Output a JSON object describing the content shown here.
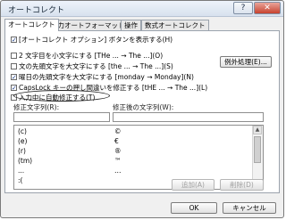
{
  "window": {
    "title": "オートコレクト",
    "help_label": "?",
    "close_label": "✕"
  },
  "tabs": [
    {
      "label": "オートコレクト"
    },
    {
      "label": "入力オートフォーマット"
    },
    {
      "label": "操作"
    },
    {
      "label": "数式オートコレクト"
    }
  ],
  "options": {
    "show_buttons": {
      "label": "[オートコレクト オプション] ボタンを表示する(H)",
      "checked_mark": "✓"
    },
    "two_initial_caps": {
      "label": "2 文字目を小文字にする [THe ... → The ...](O)"
    },
    "sentence_caps": {
      "label": "文の先頭文字を大文字にする [the ... → The ...](S)"
    },
    "day_caps": {
      "label": "曜日の先頭文字を大文字にする [monday → Monday](N)",
      "checked_mark": "✓"
    },
    "capslock_fix": {
      "label": "CapsLock キーの押し間違いを修正する [tHE ... → The ...](L)",
      "checked_mark": "✓"
    },
    "replace_typing": {
      "label": "入力中に自動修正する(T)"
    }
  },
  "exceptions_button": {
    "label": "例外処理(E)..."
  },
  "replace": {
    "col1_header": "修正文字列(R):",
    "col2_header": "修正後の文字列(W):",
    "input1_value": "",
    "input2_value": "",
    "rows": [
      {
        "from": "(c)",
        "to": "©"
      },
      {
        "from": "(e)",
        "to": "€"
      },
      {
        "from": "(r)",
        "to": "®"
      },
      {
        "from": "(tm)",
        "to": "™"
      },
      {
        "from": "...",
        "to": "…"
      },
      {
        "from": ":(",
        "to": ""
      }
    ],
    "add_button": "追加(A)",
    "delete_button": "削除(D)"
  },
  "footer": {
    "ok_label": "OK",
    "cancel_label": "キャンセル"
  }
}
